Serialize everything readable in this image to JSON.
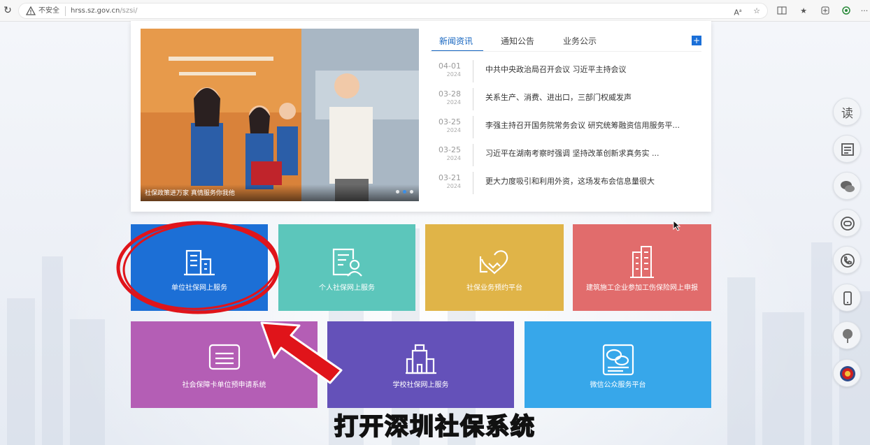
{
  "browser": {
    "security_label": "不安全",
    "url_host": "hrss.sz.gov.cn",
    "url_path": "/szsi/",
    "menu_glyph": "···"
  },
  "carousel": {
    "caption": "社保政策进万家 真情服务你我他",
    "slide_count": 3,
    "active_slide": 2
  },
  "news_tabs": [
    {
      "label": "新闻资讯",
      "active": true
    },
    {
      "label": "通知公告",
      "active": false
    },
    {
      "label": "业务公示",
      "active": false
    }
  ],
  "more_button": "+",
  "news": [
    {
      "date": "04-01",
      "year": "2024",
      "title": "中共中央政治局召开会议 习近平主持会议"
    },
    {
      "date": "03-28",
      "year": "2024",
      "title": "关系生产、消费、进出口，三部门权威发声"
    },
    {
      "date": "03-25",
      "year": "2024",
      "title": "李强主持召开国务院常务会议 研究统筹融资信用服务平..."
    },
    {
      "date": "03-25",
      "year": "2024",
      "title": "习近平在湖南考察时强调 坚持改革创新求真务实 ..."
    },
    {
      "date": "03-21",
      "year": "2024",
      "title": "更大力度吸引和利用外资，这场发布会信息量很大"
    }
  ],
  "services": [
    {
      "label": "单位社保网上服务",
      "icon": "building-icon",
      "color": "#1c6fd6"
    },
    {
      "label": "个人社保网上服务",
      "icon": "person-card-icon",
      "color": "#5cc6bb"
    },
    {
      "label": "社保业务预约平台",
      "icon": "handshake-icon",
      "color": "#e0b448"
    },
    {
      "label": "建筑施工企业参加工伤保险网上申报",
      "icon": "construction-icon",
      "color": "#e16c6c"
    },
    {
      "label": "社会保障卡单位预申请系统",
      "icon": "card-icon",
      "color": "#b45eb5"
    },
    {
      "label": "学校社保网上服务",
      "icon": "school-icon",
      "color": "#6451b9"
    },
    {
      "label": "微信公众服务平台",
      "icon": "wechat-icon",
      "color": "#37a7ea"
    }
  ],
  "side_tools": [
    {
      "name": "accessibility-icon",
      "glyph": "读"
    },
    {
      "name": "elder-mode-icon",
      "glyph": ""
    },
    {
      "name": "wechat-icon",
      "glyph": ""
    },
    {
      "name": "robot-service-icon",
      "glyph": ""
    },
    {
      "name": "phone-icon",
      "glyph": ""
    },
    {
      "name": "mobile-icon",
      "glyph": ""
    },
    {
      "name": "tree-icon",
      "glyph": ""
    },
    {
      "name": "party-emblem-icon",
      "glyph": ""
    }
  ],
  "video_subtitle": "打开深圳社保系统"
}
